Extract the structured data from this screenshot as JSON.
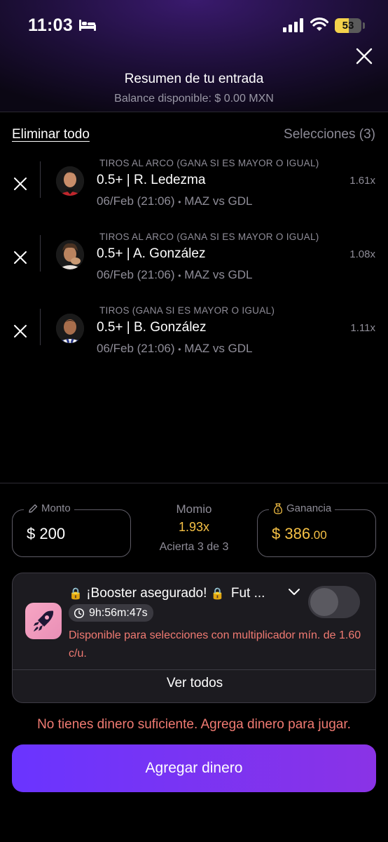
{
  "status_bar": {
    "time": "11:03",
    "battery": "53",
    "battery_level": 0.53
  },
  "header": {
    "title": "Resumen de tu entrada",
    "balance": "Balance disponible: $ 0.00 MXN"
  },
  "actions": {
    "eliminar_todo": "Eliminar todo",
    "selecciones": "Selecciones (3)"
  },
  "selections": [
    {
      "category": "TIROS AL ARCO (GANA SI ES MAYOR O IGUAL)",
      "line": "0.5+ | R. Ledezma",
      "multiplier": "1.61x",
      "date": "06/Feb (21:06)",
      "bullet": "•",
      "home": "MAZ",
      "vs": "vs",
      "away": "GDL"
    },
    {
      "category": "TIROS AL ARCO (GANA SI ES MAYOR O IGUAL)",
      "line": "0.5+ | A. González",
      "multiplier": "1.08x",
      "date": "06/Feb (21:06)",
      "bullet": "•",
      "home": "MAZ",
      "vs": "vs",
      "away": "GDL"
    },
    {
      "category": "TIROS (GANA SI ES MAYOR O IGUAL)",
      "line": "0.5+ | B. González",
      "multiplier": "1.11x",
      "date": "06/Feb (21:06)",
      "bullet": "•",
      "home": "MAZ",
      "vs": "vs",
      "away": "GDL"
    }
  ],
  "wager": {
    "monto_label": "Monto",
    "monto_value": "$ 200",
    "momio_label": "Momio",
    "momio_value": "1.93x",
    "acierta": "Acierta 3 de 3",
    "ganancia_label": "Ganancia",
    "ganancia_main": "$ 386",
    "ganancia_dec": ".00"
  },
  "booster": {
    "lock_icon": "🔒",
    "title_text": "¡Booster asegurado!",
    "title_suffix": "Fut ...",
    "timer": "9h:56m:47s",
    "description": "Disponible para selecciones con multiplicador mín. de 1.60 c/u.",
    "ver_todos": "Ver todos"
  },
  "warning": "No tienes dinero suficiente. Agrega dinero para jugar.",
  "cta": "Agregar dinero",
  "colors": {
    "accent": "#7b34f2",
    "gold": "#f6c145",
    "error": "#f07a72"
  }
}
